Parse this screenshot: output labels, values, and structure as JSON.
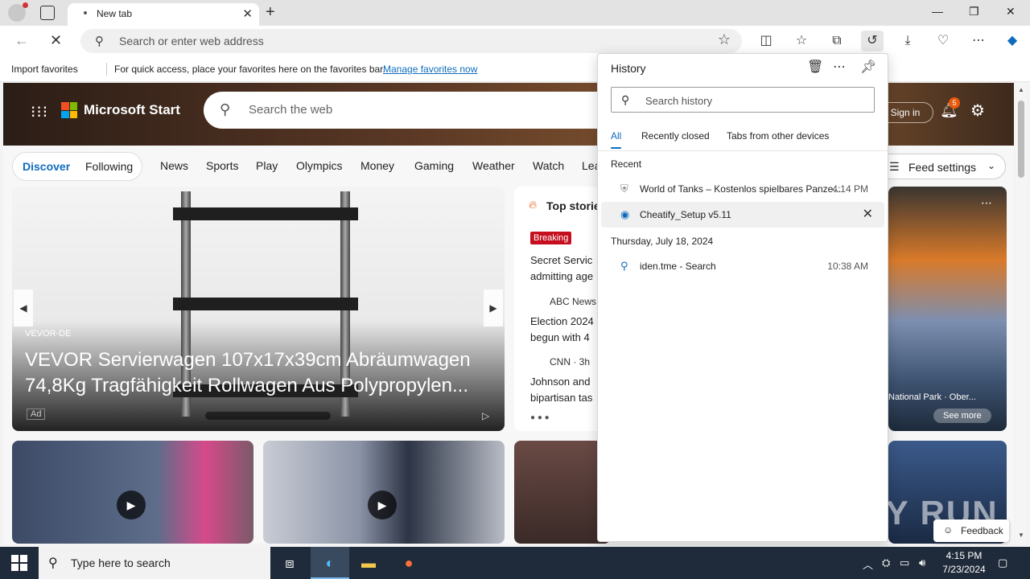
{
  "browser": {
    "tab_title": "New tab",
    "address_placeholder": "Search or enter web address",
    "favorites_bar": {
      "import_label": "Import favorites",
      "hint": "For quick access, place your favorites here on the favorites bar.",
      "manage_link": "Manage favorites now"
    }
  },
  "msn": {
    "brand": "Microsoft Start",
    "search_placeholder": "Search the web",
    "signin": "Sign in",
    "notification_count": "5",
    "tabs": {
      "discover": "Discover",
      "following": "Following"
    },
    "nav": [
      "News",
      "Sports",
      "Play",
      "Olympics",
      "Money",
      "Gaming",
      "Weather",
      "Watch",
      "Lea"
    ],
    "feed_settings": "Feed settings",
    "hero_card": {
      "source": "VEVOR-DE",
      "headline": "VEVOR Servierwagen 107x17x39cm Abräumwagen 74,8Kg Tragfähigkeit Rollwagen Aus Polypropylen...",
      "ad_label": "Ad"
    },
    "top_stories": {
      "title": "Top storie",
      "breaking": "Breaking",
      "story1": [
        "Secret Servic",
        "admitting age"
      ],
      "source2": "ABC News",
      "story2": [
        "Election 2024",
        "begun with 4"
      ],
      "source3": "CNN · 3h",
      "story3": [
        "Johnson and",
        "bipartisan tas"
      ]
    },
    "image_card": {
      "caption": "National Park · Ober...",
      "see_more": "See more"
    },
    "feedback": "Feedback",
    "watermark": "ANY RUN"
  },
  "history": {
    "title": "History",
    "search_placeholder": "Search history",
    "tabs": [
      "All",
      "Recently closed",
      "Tabs from other devices"
    ],
    "sections": [
      {
        "label": "Recent",
        "items": [
          {
            "name": "World of Tanks – Kostenlos spielbares Panze...",
            "time": "4:14 PM"
          },
          {
            "name": "Cheatify_Setup v5.11",
            "time": ""
          }
        ]
      },
      {
        "label": "Thursday, July 18, 2024",
        "items": [
          {
            "name": "iden.tme - Search",
            "time": "10:38 AM"
          }
        ]
      }
    ]
  },
  "taskbar": {
    "search_placeholder": "Type here to search",
    "time": "4:15 PM",
    "date": "7/23/2024"
  }
}
